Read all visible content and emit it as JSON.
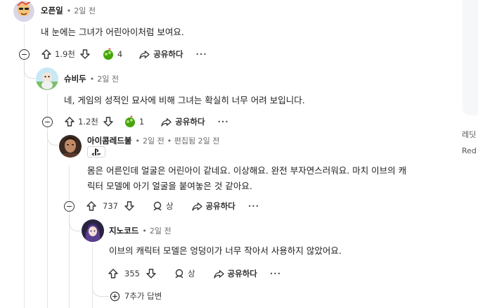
{
  "comments": [
    {
      "username": "오픈일",
      "separator": "•",
      "time": "2일 전",
      "body": "내 눈에는 그녀가 어린아이처럼 보여요.",
      "upvotes": "1.9천",
      "awards": "4",
      "share_label": "공유하다"
    },
    {
      "username": "슈비두",
      "separator": "•",
      "time": "2일 전",
      "body": "네, 게임의 성적인 묘사에 비해 그녀는 확실히 너무 어려 보입니다.",
      "upvotes": "1.2천",
      "awards": "1",
      "share_label": "공유하다"
    },
    {
      "username": "아이콤레드불",
      "separator": "•",
      "time": "2일 전",
      "edited": "• 편집됨 2일 전",
      "flair_icon": "playstation-icon",
      "body_line1": "몸은 어른인데 얼굴은 어린아이 같네요. 이상해요. 완전 부자연스러워요. 마치 이브의 캐",
      "body_line2": "릭터 모델에 아기 얼굴을 붙여놓은 것 같아요.",
      "upvotes": "737",
      "award_label": "상",
      "share_label": "공유하다"
    },
    {
      "username": "지노코드",
      "separator": "•",
      "time": "2일 전",
      "body": "이브의 캐릭터 모델은 엉덩이가 너무 작아서 사용하지 않았어요.",
      "upvotes": "355",
      "award_label": "상",
      "share_label": "공유하다"
    }
  ],
  "more_replies": "7추가 답변",
  "more_label": "···",
  "sidebar": {
    "text1": "레딧",
    "text2": "Red"
  },
  "colors": {
    "text": "#1c1c1c",
    "meta": "#6b6b6b",
    "line": "#e5e5e5",
    "award_green": "#46a508"
  }
}
